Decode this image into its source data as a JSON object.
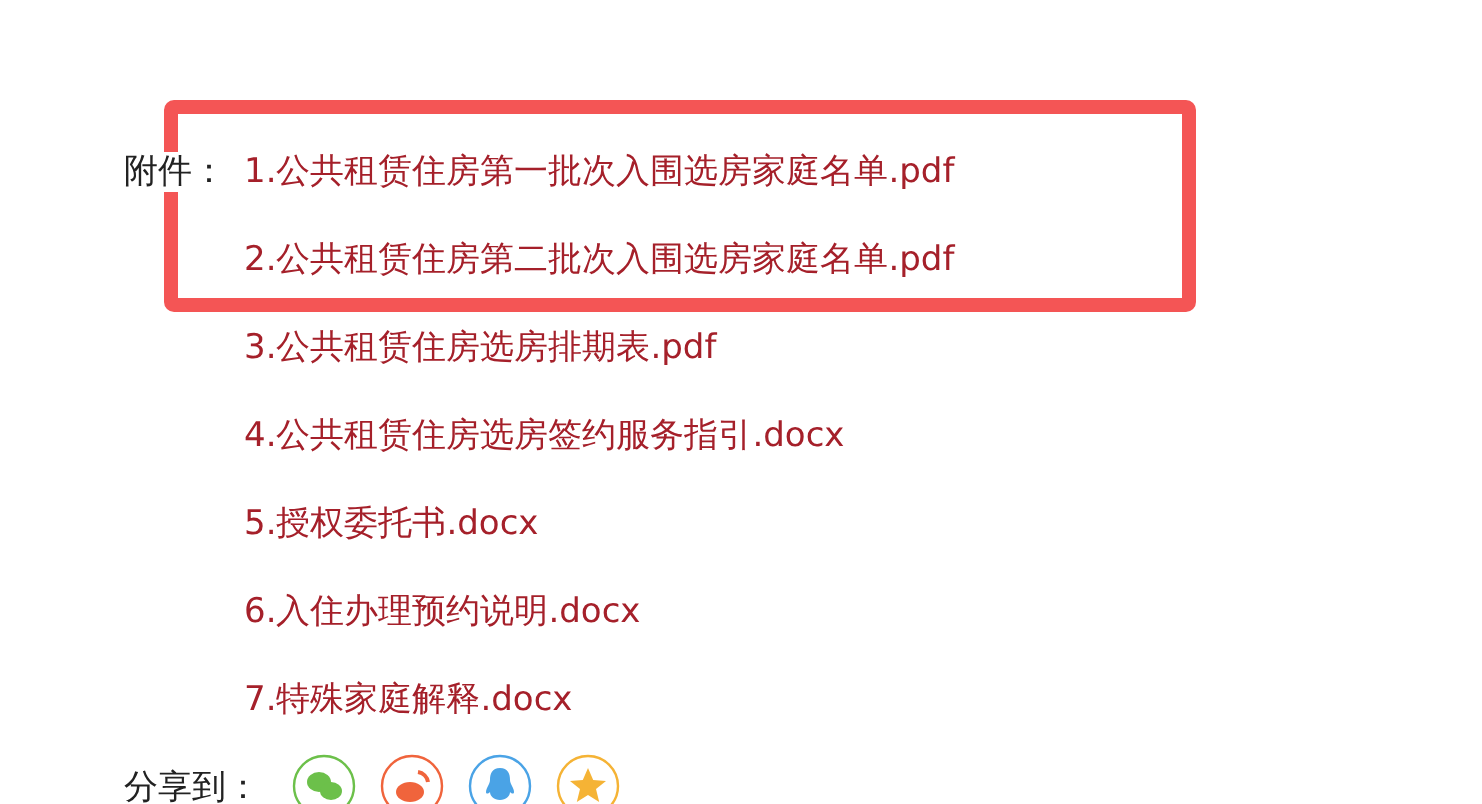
{
  "attachments": {
    "label": "附件：",
    "highlighted_files": [
      {
        "name": "1.公共租赁住房第一批次入围选房家庭名单.pdf"
      },
      {
        "name": "2.公共租赁住房第二批次入围选房家庭名单.pdf"
      }
    ],
    "files": [
      {
        "name": "3.公共租赁住房选房排期表.pdf"
      },
      {
        "name": "4.公共租赁住房选房签约服务指引.docx"
      },
      {
        "name": "5.授权委托书.docx"
      },
      {
        "name": "6.入住办理预约说明.docx"
      },
      {
        "name": "7.特殊家庭解释.docx"
      }
    ]
  },
  "share": {
    "label": "分享到：",
    "targets": [
      {
        "kind": "wechat",
        "color": "#6cc04a"
      },
      {
        "kind": "weibo",
        "color": "#f0643c"
      },
      {
        "kind": "qq",
        "color": "#4aa3e6"
      },
      {
        "kind": "qzone",
        "color": "#f5b335"
      }
    ]
  }
}
